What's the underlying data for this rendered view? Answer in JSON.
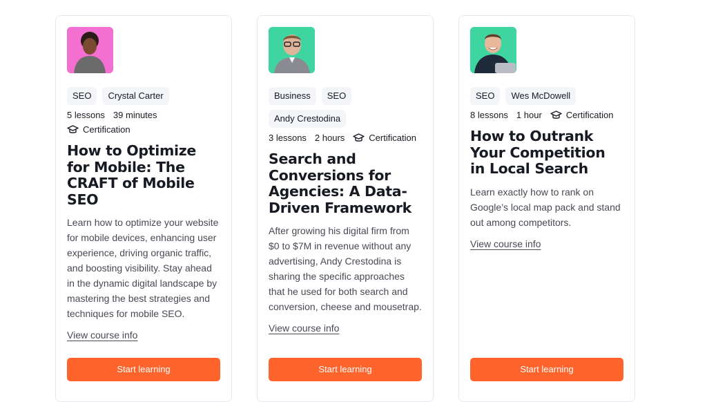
{
  "courses": [
    {
      "avatar_bg": "#F46FD2",
      "tags": [
        "SEO",
        "Crystal Carter"
      ],
      "lessons": "5 lessons",
      "duration": "39 minutes",
      "certification": "Certification",
      "title": "How to Optimize for Mobile: The CRAFT of Mobile SEO",
      "description": "Learn how to optimize your website for mobile devices, enhancing user experience, driving organic traffic, and boosting visibility. Stay ahead in the dynamic digital landscape by mastering the best strategies and techniques for mobile SEO.",
      "link": "View course info",
      "button": "Start learning"
    },
    {
      "avatar_bg": "#3FD5A0",
      "tags": [
        "Business",
        "SEO",
        "Andy Crestodina"
      ],
      "lessons": "3 lessons",
      "duration": "2 hours",
      "certification": "Certification",
      "title": "Search and Conversions for Agencies: A Data-Driven Framework",
      "description": "After growing his digital firm from $0 to $7M in revenue without any advertising, Andy Crestodina is sharing the specific approaches that he used for both search and conversion, cheese and mousetrap.",
      "link": "View course info",
      "button": "Start learning"
    },
    {
      "avatar_bg": "#3FD5A0",
      "tags": [
        "SEO",
        "Wes McDowell"
      ],
      "lessons": "8 lessons",
      "duration": "1 hour",
      "certification": "Certification",
      "title": "How to Outrank Your Competition in Local Search",
      "description": "Learn exactly how to rank on Google’s local map pack and stand out among competitors.",
      "link": "View course info",
      "button": "Start learning"
    }
  ],
  "colors": {
    "accent": "#FF642D",
    "tag_bg": "#F4F5F9",
    "text": "#171A22",
    "muted": "#484A54"
  }
}
